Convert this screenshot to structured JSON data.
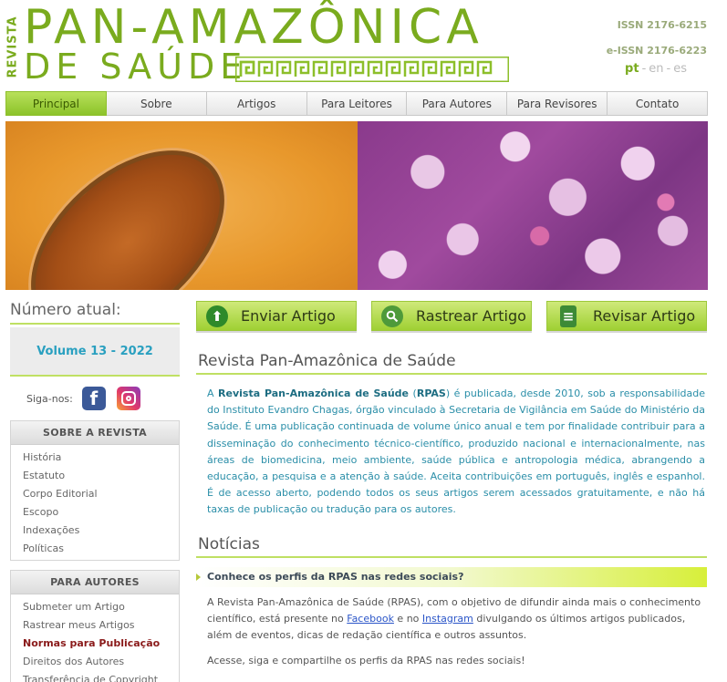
{
  "header": {
    "logo_vertical": "REVISTA",
    "logo_line1": "PAN-AMAZÔNICA",
    "logo_line2": "DE SAÚDE",
    "issn": "ISSN 2176-6215",
    "eissn": "e-ISSN 2176-6223",
    "lang": {
      "pt": "pt",
      "en": "en",
      "es": "es",
      "sep": "-"
    }
  },
  "nav": [
    {
      "label": "Principal",
      "active": true
    },
    {
      "label": "Sobre"
    },
    {
      "label": "Artigos"
    },
    {
      "label": "Para Leitores"
    },
    {
      "label": "Para Autores"
    },
    {
      "label": "Para Revisores"
    },
    {
      "label": "Contato"
    }
  ],
  "sidebar": {
    "current_issue_label": "Número atual:",
    "volume": "Volume 13 - 2022",
    "follow_label": "Siga-nos:",
    "social": [
      {
        "icon": "facebook-icon",
        "glyph": "f"
      },
      {
        "icon": "instagram-icon"
      }
    ],
    "about": {
      "title": "SOBRE A REVISTA",
      "items": [
        "História",
        "Estatuto",
        "Corpo Editorial",
        "Escopo",
        "Indexações",
        "Políticas"
      ]
    },
    "authors": {
      "title": "PARA AUTORES",
      "items": [
        "Submeter um Artigo",
        "Rastrear meus Artigos",
        "Normas para Publicação",
        "Direitos dos Autores",
        "Transferência de Copyright"
      ]
    }
  },
  "actions": [
    {
      "label": "Enviar Artigo",
      "icon": "upload-icon",
      "glyph": "⬆"
    },
    {
      "label": "Rastrear Artigo",
      "icon": "search-icon",
      "glyph": "🔍"
    },
    {
      "label": "Revisar Artigo",
      "icon": "book-icon",
      "glyph": "≡"
    }
  ],
  "main": {
    "title": "Revista Pan-Amazônica de Saúde",
    "intro_prefix": "A ",
    "intro_name": "Revista Pan-Amazônica de Saúde",
    "intro_open": " (",
    "intro_abbr": "RPAS",
    "intro_rest": ") é publicada, desde 2010, sob a responsabilidade do Instituto Evandro Chagas, órgão vinculado à Secretaria de Vigilância em Saúde do Ministério da Saúde. É uma publicação continuada de volume único anual e tem por finalidade contribuir para a disseminação do conhecimento técnico-científico, produzido nacional e internacionalmente, nas áreas de biomedicina, meio ambiente, saúde pública e antropologia médica, abrangendo a educação, a pesquisa e a atenção à saúde. Aceita contribuições em português, inglês e espanhol. É de acesso aberto, podendo todos os seus artigos serem acessados gratuitamente, e não há taxas de publicação ou tradução para os autores.",
    "news_title": "Notícias",
    "news_headline": "Conhece os perfis da RPAS nas redes sociais?",
    "news_p1_a": "A Revista Pan-Amazônica de Saúde (RPAS), com o objetivo de difundir ainda mais o conhecimento científico, está presente no ",
    "news_link_fb": "Facebook",
    "news_p1_b": " e no ",
    "news_link_ig": "Instagram",
    "news_p1_c": " divulgando os últimos artigos publicados, além de eventos, dicas de redação científica e outros assuntos.",
    "news_p2": "Acesse, siga e compartilhe os perfis da RPAS nas redes sociais!"
  }
}
